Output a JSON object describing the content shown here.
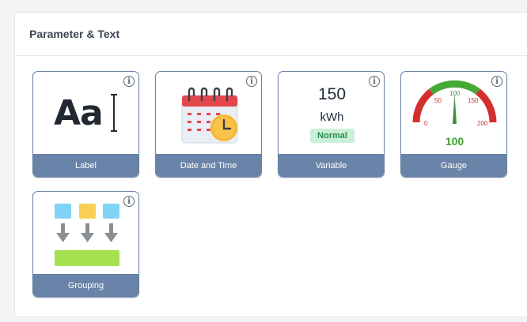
{
  "panel": {
    "title": "Parameter & Text"
  },
  "cards": [
    {
      "label": "Label",
      "preview_text": "Aa"
    },
    {
      "label": "Date and Time"
    },
    {
      "label": "Variable",
      "value": "150",
      "unit": "kWh",
      "status": "Normal"
    },
    {
      "label": "Gauge",
      "ticks": [
        "0",
        "50",
        "100",
        "150",
        "200"
      ],
      "value": "100"
    },
    {
      "label": "Grouping"
    }
  ],
  "info_glyph": "i",
  "icons": [
    "info-icon",
    "text-label-icon",
    "calendar-clock-icon",
    "gauge-icon",
    "grouping-icon"
  ],
  "colors": {
    "card_footer": "#6a83a8",
    "status_bg": "#c9efd6",
    "status_text": "#2b8a4b",
    "gauge_green": "#3f9d2f",
    "gauge_red": "#d32f2f"
  }
}
